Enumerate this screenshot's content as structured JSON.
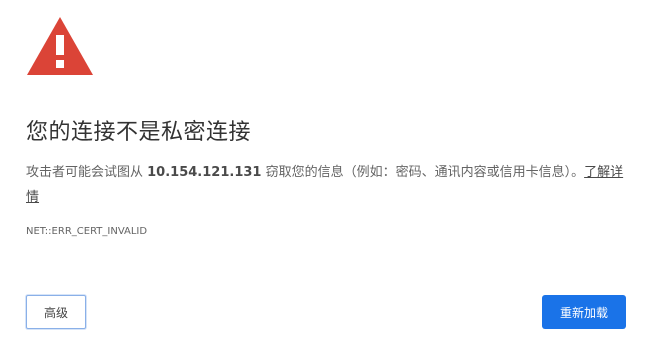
{
  "title": "您的连接不是私密连接",
  "message": {
    "prefix": "攻击者可能会试图从 ",
    "ip": "10.154.121.131",
    "suffix": " 窃取您的信息（例如：密码、通讯内容或信用卡信息）。",
    "learn_more": "了解详情"
  },
  "error_code": "NET::ERR_CERT_INVALID",
  "buttons": {
    "advanced": "高级",
    "reload": "重新加载"
  },
  "colors": {
    "warning": "#db4437",
    "primary": "#1a73e8"
  },
  "icon": "warning-triangle-icon"
}
